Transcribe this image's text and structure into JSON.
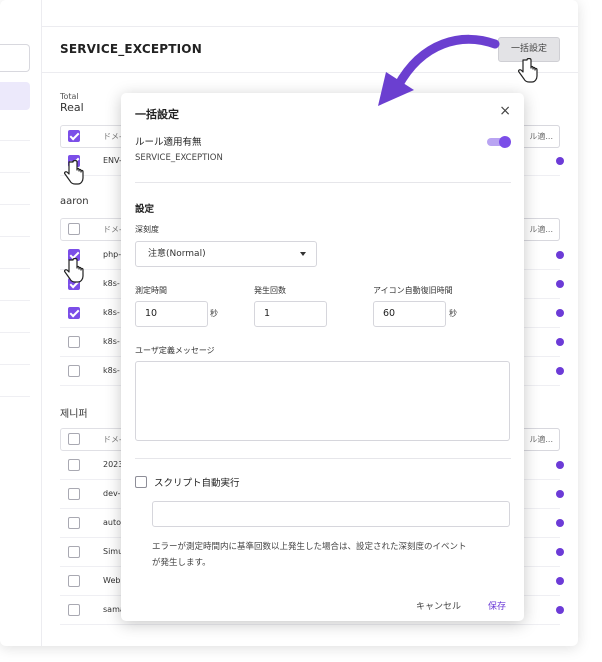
{
  "page": {
    "title": "SERVICE_EXCEPTION",
    "bulk_button": "一括設定",
    "total_label": "Total",
    "real_label": "Real"
  },
  "groups": [
    {
      "label": "",
      "header_col": "ドメ-",
      "header_btn": "ル適...",
      "rows": [
        {
          "text": "ENV-",
          "checked": true
        }
      ]
    },
    {
      "label": "aaron",
      "header_col": "ドメ-",
      "header_btn": "ル適...",
      "rows": [
        {
          "text": "php-",
          "checked": true
        },
        {
          "text": "k8s-",
          "checked": true
        },
        {
          "text": "k8s-",
          "checked": true
        },
        {
          "text": "k8s-",
          "checked": false
        },
        {
          "text": "k8s-",
          "checked": false
        }
      ]
    },
    {
      "label": "제니퍼",
      "header_col": "ドメ-",
      "header_btn": "ル適...",
      "rows": [
        {
          "text": "2023",
          "checked": false
        },
        {
          "text": "dev-",
          "checked": false
        },
        {
          "text": "auto",
          "checked": false
        },
        {
          "text": "Simu",
          "checked": false
        },
        {
          "text": "Web",
          "checked": false
        },
        {
          "text": "sama",
          "checked": false
        }
      ]
    }
  ],
  "modal": {
    "title": "一括設定",
    "close": "×",
    "rule_label": "ルール適用有無",
    "rule_value": "SERVICE_EXCEPTION",
    "rule_enabled": true,
    "settings_label": "設定",
    "severity_label": "深刻度",
    "severity_value": "注意(Normal)",
    "measure_time_label": "測定時間",
    "measure_time_value": "10",
    "measure_time_unit": "秒",
    "occurrence_label": "発生回数",
    "occurrence_value": "1",
    "icon_recovery_label": "アイコン自動復旧時間",
    "icon_recovery_value": "60",
    "icon_recovery_unit": "秒",
    "user_message_label": "ユーザ定義メッセージ",
    "user_message_value": "",
    "script_label": "スクリプト自動実行",
    "script_checked": false,
    "script_value": "",
    "description_line1": "エラーが測定時間内に基準回数以上発生した場合は、設定された深刻度のイベント",
    "description_line2": "が発生します。",
    "cancel_label": "キャンセル",
    "save_label": "保存"
  },
  "colors": {
    "accent": "#7b4ee8",
    "accent_dark": "#6c3bd7",
    "arrow": "#6b3fd0"
  }
}
